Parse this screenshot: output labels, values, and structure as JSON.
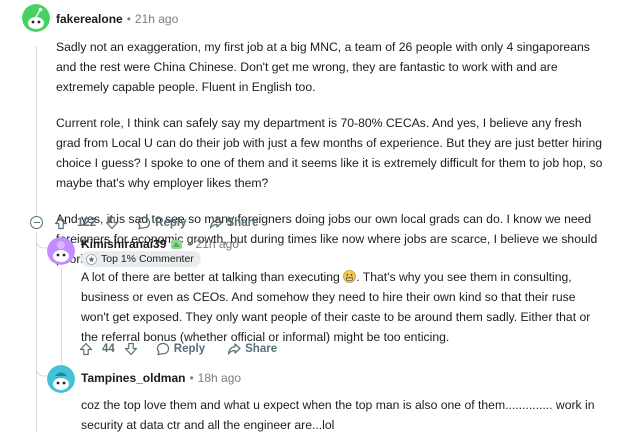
{
  "comments": [
    {
      "author": "fakerealone",
      "time": "21h ago",
      "paragraphs": [
        "Sadly not an exaggeration, my first job at a big MNC, a team of 26 people with only 4 singaporeans and the rest were China Chinese. Don't get me wrong, they are fantastic to work with and are extremely capable people. Fluent in English too.",
        "Current role, I think can safely say my department is 70-80% CECAs. And yes, I believe any fresh grad from Local U can do their job with just a few months of experience. But they are just better hiring choice I guess? I spoke to one of them and it seems like it is extremely difficult for them to job hop, so maybe that's why employer likes them?",
        "And yes, it is sad to see so many foreigners doing jobs our own local grads can do. I know we need foreigners for economic growth, but during times like now where jobs are scarce, I believe we should prioritise our own."
      ],
      "votes": "122",
      "reply_label": "Reply",
      "share_label": "Share"
    },
    {
      "author": "Kimishiranai39",
      "time": "21h ago",
      "flair": "Top 1% Commenter",
      "text_before_emoji": "A lot of there are better at talking than executing",
      "text_after_emoji": ". That's why you see them in consulting, business or even as CEOs. And somehow they need to hire their own kind so that their ruse won't get exposed. They only want people of their caste to be around them sadly. Either that or the referral bonus (whether official or informal) might be too enticing.",
      "votes": "44",
      "reply_label": "Reply",
      "share_label": "Share"
    },
    {
      "author": "Tampines_oldman",
      "time": "18h ago",
      "text": "coz the top love them and what u expect when the top man is also one of them.............. work in security at data ctr and all the engineer are...lol"
    }
  ],
  "separator": "•",
  "icons": {
    "upvote": "arrow-up-icon",
    "downvote": "arrow-down-icon",
    "reply": "speech-bubble-icon",
    "share": "share-arrow-icon",
    "collapse": "minus-circle-icon",
    "flair_badge": "trophy-badge-icon",
    "emoji": "grimace-emoji-icon",
    "mod_badge": "green-badge-icon"
  },
  "colors": {
    "meta_gray": "#7c7c7c",
    "action_gray": "#576f76",
    "thread_line": "#dcdcdc",
    "flair_bg": "#eaedef",
    "avatar1_bg": "#46d160",
    "avatar2_bg": "#c18dff",
    "avatar3_bg": "#43c3d6"
  }
}
